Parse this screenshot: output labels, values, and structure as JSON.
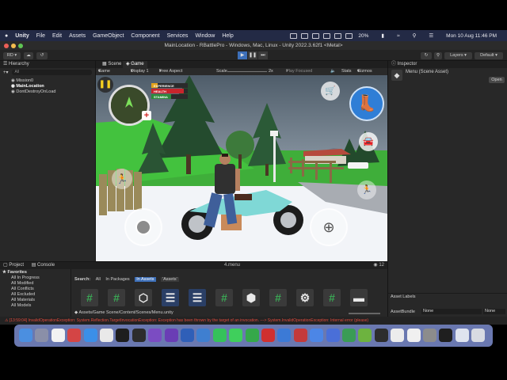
{
  "menubar": {
    "app": "Unity",
    "items": [
      "File",
      "Edit",
      "Assets",
      "GameObject",
      "Component",
      "Services",
      "Window",
      "Help"
    ],
    "battery": "20%",
    "datetime": "Mon 10 Aug  11:46 PM"
  },
  "window": {
    "title": "MainLocation - RBattlePro - Windows, Mac, Linux - Unity 2022.3.62f1 <Metal>"
  },
  "toolbar": {
    "account": "RD",
    "layers": "Layers",
    "layout": "Default"
  },
  "hierarchy": {
    "tab": "Hierarchy",
    "search_placeholder": "All",
    "items": [
      "Mission0",
      "MainLocation",
      "DontDestroyOnLoad"
    ]
  },
  "scene_tabs": {
    "scene": "Scene",
    "game": "Game"
  },
  "game_bar": {
    "mode": "Game",
    "display": "Display 1",
    "aspect": "Free Aspect",
    "scale_label": "Scale",
    "scale_value": "2x",
    "play_focused": "Play Focused",
    "stats": "Stats",
    "gizmos": "Gizmos"
  },
  "hud": {
    "bars": [
      {
        "label": "EXPERIENCE",
        "value": 0.18,
        "color": "#e3a21a"
      },
      {
        "label": "HEALTH",
        "value": 0.9,
        "color": "#c8252c"
      },
      {
        "label": "STAMINA",
        "value": 0.55,
        "color": "#2d8a3a"
      }
    ]
  },
  "inspector": {
    "tab": "Inspector",
    "object": "Menu (Scene Asset)",
    "open_button": "Open",
    "asset_labels": "Asset Labels",
    "asset_bundle_label": "AssetBundle",
    "asset_bundle_value": "None",
    "variant_value": "None"
  },
  "project": {
    "tabs": [
      "Project",
      "Console"
    ],
    "favorites_title": "Favorites",
    "favorites": [
      "All In Progress",
      "All Modified",
      "All Conflicts",
      "All Excluded",
      "All Materials",
      "All Models"
    ],
    "selected_file": "4.menu",
    "search_label": "Search:",
    "filters": [
      "All",
      "In Packages",
      "In Assets",
      "'Assets'"
    ],
    "path": "Assets/Game Scene/Content/Scenes/Menu.unity",
    "asset_count": "12",
    "assets": [
      {
        "icon": "script-icon",
        "color": "#3a3a3a"
      },
      {
        "icon": "script-icon",
        "color": "#3a3a3a"
      },
      {
        "icon": "unity-cube-icon",
        "color": "#3a3a3a"
      },
      {
        "icon": "list-icon",
        "color": "#2a3f66"
      },
      {
        "icon": "list-icon",
        "color": "#2a3f66"
      },
      {
        "icon": "script-icon",
        "color": "#3a3a3a"
      },
      {
        "icon": "prefab-script-icon",
        "color": "#3a3a3a"
      },
      {
        "icon": "script-icon",
        "color": "#3a3a3a"
      },
      {
        "icon": "settings-asset-icon",
        "color": "#3a3a3a"
      },
      {
        "icon": "script-icon",
        "color": "#3a3a3a"
      },
      {
        "icon": "folder-icon",
        "color": "#3a3a3a"
      }
    ]
  },
  "status_bar": {
    "error": "[13:59:04] InvalidOperationException: System.Reflection.TargetInvocationException: Exception has been thrown by the target of an invocation. ---> System.InvalidOperationException: Internal error (please)"
  },
  "dock": {
    "apps": [
      {
        "icon": "finder-icon",
        "color": "#4b8fe0"
      },
      {
        "icon": "launchpad-icon",
        "color": "#8a8fa8"
      },
      {
        "icon": "chrome-icon",
        "color": "#f2f2f2"
      },
      {
        "icon": "red-app-icon",
        "color": "#d44545"
      },
      {
        "icon": "safari-icon",
        "color": "#3b8fe8"
      },
      {
        "icon": "clock-app-icon",
        "color": "#e9e9e9"
      },
      {
        "icon": "terminal-icon",
        "color": "#1e1e1e"
      },
      {
        "icon": "activity-monitor-icon",
        "color": "#2c2c2c"
      },
      {
        "icon": "visual-studio-icon",
        "color": "#7b4cc2"
      },
      {
        "icon": "visual-studio-icon",
        "color": "#6a3db5"
      },
      {
        "icon": "word-icon",
        "color": "#2f5fb8"
      },
      {
        "icon": "mp3-app-icon",
        "color": "#3f7fd0"
      },
      {
        "icon": "whatsapp-icon",
        "color": "#35c25a"
      },
      {
        "icon": "messages-icon",
        "color": "#3fcf5c"
      },
      {
        "icon": "camtasia-icon",
        "color": "#35a84a"
      },
      {
        "icon": "red-p-app-icon",
        "color": "#d0302f"
      },
      {
        "icon": "xcode-like-icon",
        "color": "#3c7ad6"
      },
      {
        "icon": "red-app-icon",
        "color": "#c43a3a"
      },
      {
        "icon": "xcode-icon",
        "color": "#4c86e6"
      },
      {
        "icon": "blue-app-icon",
        "color": "#4a6fd8"
      },
      {
        "icon": "android-studio-icon",
        "color": "#3a9c55"
      },
      {
        "icon": "android-icon",
        "color": "#6db33f"
      },
      {
        "icon": "unity-hub-icon",
        "color": "#2d2d2d"
      },
      {
        "icon": "preview-icon",
        "color": "#ececec"
      },
      {
        "icon": "photos-icon",
        "color": "#f0f0f0"
      },
      {
        "icon": "system-settings-icon",
        "color": "#8c8c8c"
      },
      {
        "icon": "unity-icon",
        "color": "#1f1f1f"
      },
      {
        "icon": "downloads-icon",
        "color": "#dfe4ef"
      },
      {
        "icon": "trash-icon",
        "color": "#d8dbe2"
      }
    ]
  }
}
